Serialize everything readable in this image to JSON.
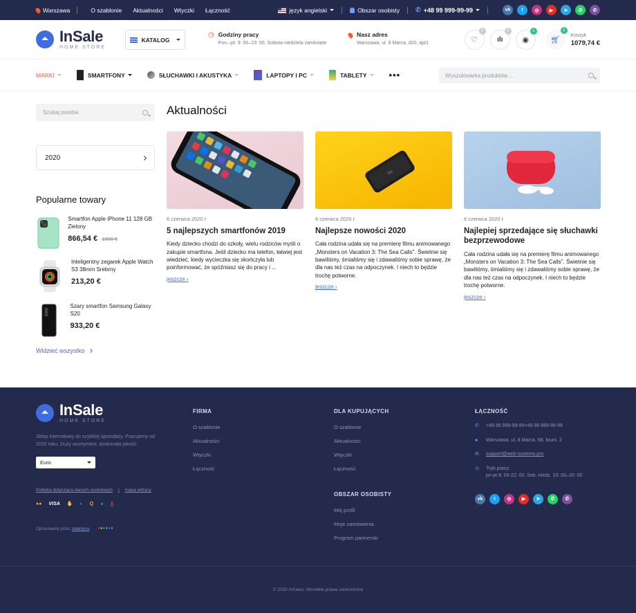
{
  "topbar": {
    "city": "Warszawa",
    "links": [
      "O szablonie",
      "Aktualności",
      "Wtyczki",
      "Łączność"
    ],
    "language": "język angielski",
    "account": "Obszar osobisty",
    "phone": "+48 99 999-99-99",
    "socials": [
      {
        "icon": "vk-icon",
        "color": "#4a76a8",
        "glyph": "vk"
      },
      {
        "icon": "twitter-icon",
        "color": "#1da1f2",
        "glyph": "t"
      },
      {
        "icon": "instagram-icon",
        "color": "#c13584",
        "glyph": "◎"
      },
      {
        "icon": "youtube-icon",
        "color": "#e52d27",
        "glyph": "▶"
      },
      {
        "icon": "telegram-icon",
        "color": "#2ca5e0",
        "glyph": "➤"
      },
      {
        "icon": "whatsapp-icon",
        "color": "#25d366",
        "glyph": "✆"
      },
      {
        "icon": "viber-icon",
        "color": "#7b519d",
        "glyph": "✆"
      }
    ]
  },
  "header": {
    "logo_name": "InSale",
    "logo_sub": "HOME STORE",
    "catalog": "KATALOG",
    "hours_title": "Godziny pracy",
    "hours_text": "Pon.–pt. 9: 00–23: 00, Sobota-niedziela zamknięte",
    "address_title": "Nasz adres",
    "address_text": "Warszawa, ul. 8 Marca, d20, apt1",
    "badges": {
      "wishlist": "0",
      "compare": "0",
      "viewed": "1",
      "cart": "2"
    },
    "cart_label": "Koszyk",
    "cart_amount": "1079,74 €"
  },
  "nav": {
    "items": [
      {
        "label": "MARKI"
      },
      {
        "label": "SMARTFONY"
      },
      {
        "label": "SŁUCHAWKI I AKUSTYKA"
      },
      {
        "label": "LAPTOPY I PC"
      },
      {
        "label": "TABLETY"
      }
    ],
    "more": "•••",
    "search_placeholder": "Wyszukiwarka produktów ..."
  },
  "sidebar": {
    "search_placeholder": "Szukaj postów",
    "year": "2020",
    "popular_title": "Popularne towary",
    "products": [
      {
        "name": "Smartfon Apple iPhone 11 128 GB Zielony",
        "price": "866,54 €",
        "old_price": "1000 €"
      },
      {
        "name": "Inteligentny zegarek Apple Watch S3 38mm Srebrny",
        "price": "213,20 €",
        "old_price": ""
      },
      {
        "name": "Szary smartfon Samsung Galaxy S20",
        "price": "933,20 €",
        "old_price": ""
      }
    ],
    "see_all": "Widzieć wszystko"
  },
  "main": {
    "title": "Aktualności",
    "posts": [
      {
        "date": "6 czerwca 2020 r",
        "title": "5 najlepszych smartfonów 2019",
        "text": "Kiedy dziecko chodzi do szkoły, wielu rodziców myśli o zakupie smartfona. Jeśli dziecko ma telefon, łatwiej jest wiedzieć, kiedy wycieczka się skończyła lub poinformować, że spóźniasz się do pracy i ...",
        "more": "jeszcze"
      },
      {
        "date": "6 czerwca 2020 r",
        "title": "Najlepsze nowości 2020",
        "text": "Cała rodzina udała się na premierę filmu animowanego „Monsters on Vacation 3: The Sea Calls\". Świetnie się bawiliśmy, śmialiśmy się i zdawaliśmy sobie sprawę, że dla nas też czas na odpoczynek. I niech to będzie trochę potworne.",
        "more": "jeszcze"
      },
      {
        "date": "6 czerwca 2020 r",
        "title": "Najlepiej sprzedające się słuchawki bezprzewodowe",
        "text": "Cała rodzina udała się na premierę filmu animowanego „Monsters on Vacation 3: The Sea Calls\". Świetnie się bawiliśmy, śmialiśmy się i zdawaliśmy sobie sprawę, że dla nas też czas na odpoczynek. I niech to będzie trochę potworne.",
        "more": "jeszcze"
      }
    ]
  },
  "footer": {
    "about": "Sklep internetowy do szybkiej sprzedaży. Pracujemy od 2020 roku. Duży asortyment, doskonała jakość.",
    "currency": "Euro",
    "policy": "Polityka dotycząca danych osobowych",
    "sitemap": "mapa witryny",
    "payments": [
      "●●",
      "VISA",
      "✋",
      "◐",
      "Q",
      "◕",
      "A"
    ],
    "dev_prefix": "Opracowany przez",
    "dev_link": "steemy.ru",
    "firma_title": "FIRMA",
    "firma_links": [
      "O szablonie",
      "Aktualności",
      "Wtyczki",
      "Łączność"
    ],
    "buyers_title": "DLA KUPUJĄCYCH",
    "buyers_links": [
      "O szablonie",
      "Aktualności",
      "Wtyczki",
      "Łączność"
    ],
    "account_title": "OBSZAR OSOBISTY",
    "account_links": [
      "Mój profil",
      "Moje zamówienia",
      "Program partnerski"
    ],
    "contact_title": "ŁĄCZNOŚĆ",
    "phones": "+48 99 999-99-99+48 99 999-99-98",
    "address": "Warszawa, ul. 8 Marca, 68, biuro. 2",
    "email": "support@web-systems.pro",
    "hours_label": "Tryb pracy:",
    "hours": "pn-pt 9: 00-22: 00, Sob.-niedz. 10: 00–20: 00",
    "copyright": "© 2020 InSales. Wszelkie prawa zastrzeżone"
  }
}
